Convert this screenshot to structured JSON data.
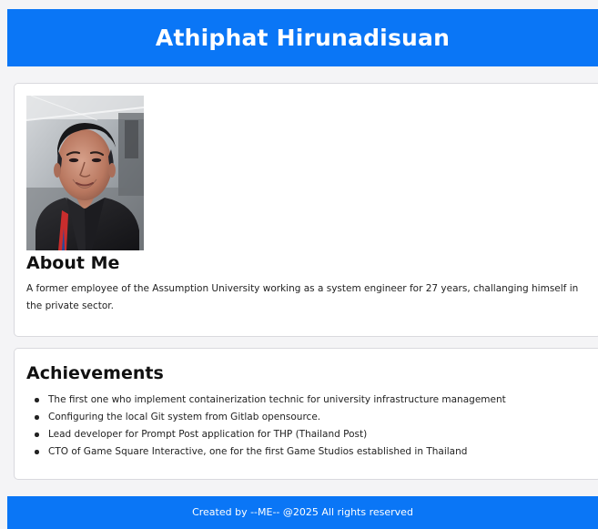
{
  "header": {
    "title": "Athiphat Hirunadisuan"
  },
  "about": {
    "photo_icon": "profile-photo",
    "title": "About Me",
    "text": "A former employee of the Assumption University working as a system engineer for 27 years, challanging himself in the private sector."
  },
  "achievements": {
    "title": "Achievements",
    "items": [
      "The first one who implement containerization technic for university infrastructure management",
      "Configuring the local Git system from Gitlab opensource.",
      "Lead developer for Prompt Post application for THP (Thailand Post)",
      "CTO of Game Square Interactive, one for the first Game Studios established in Thailand"
    ]
  },
  "footer": {
    "text": "Created by --ME-- @2025 All rights reserved"
  },
  "colors": {
    "primary": "#0a76f6",
    "background": "#f4f4f6",
    "card": "#ffffff"
  }
}
